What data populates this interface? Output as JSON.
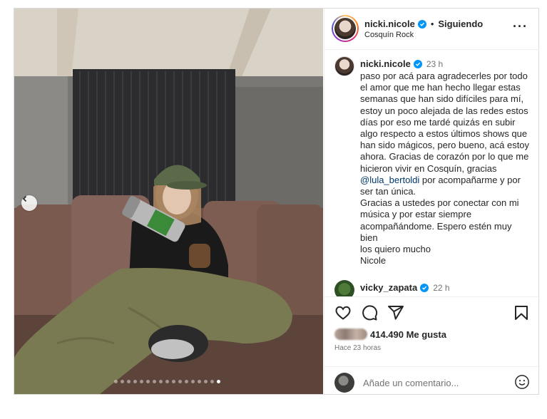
{
  "header": {
    "username": "nicki.nicole",
    "separator": "•",
    "follow_status": "Siguiendo",
    "location": "Cosquín Rock",
    "more_icon": "more-horizontal-icon"
  },
  "caption": {
    "username": "nicki.nicole",
    "time": "23 h",
    "text_before_mention": "paso por acá para agradecerles por todo el amor que me han hecho llegar estas semanas que han sido difíciles para mí, estoy un poco alejada de las redes estos días por eso me tardé quizás en subir algo respecto a estos últimos shows que han sido mágicos, pero bueno, acá estoy ahora. Gracias de corazón por lo que me hicieron vivir en Cosquín, gracias ",
    "mention": "@lula_bertoldi",
    "text_after_mention": " por acompañarme y por ser tan única.\nGracias a ustedes por conectar con mi música y por estar siempre acompañándome. Espero estén muy bien\nlos quiero mucho\nNicole"
  },
  "comment2": {
    "username": "vicky_zapata",
    "time": "22 h"
  },
  "actions": {
    "likes": "414.490 Me gusta",
    "time_ago": "Hace 23 horas",
    "icons": [
      "heart-icon",
      "comment-icon",
      "share-icon",
      "bookmark-icon"
    ]
  },
  "add_comment": {
    "placeholder": "Añade un comentario...",
    "emoji_icon": "emoji-icon"
  },
  "carousel": {
    "total_slides": 17,
    "active_index": 16
  },
  "colors": {
    "verified": "#0095f6",
    "mention": "#00376b",
    "secondary_text": "#737373"
  }
}
